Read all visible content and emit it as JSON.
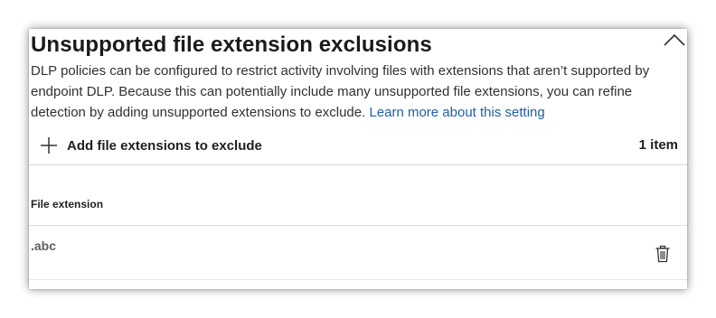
{
  "section": {
    "title": "Unsupported file extension exclusions",
    "description": "DLP policies can be configured to restrict activity involving files with extensions that aren’t supported by endpoint DLP. Because this can potentially include many unsupported file extensions, you can refine detection by adding unsupported extensions to exclude.",
    "learn_more_link": "Learn more about this setting",
    "collapse_icon": "chevron-up-icon"
  },
  "toolbar": {
    "add_label": "Add file extensions to exclude",
    "add_icon": "plus-icon",
    "item_count": "1 item"
  },
  "table": {
    "column_header": "File extension",
    "rows": [
      {
        "extension": ".abc",
        "delete_icon": "trash-icon"
      }
    ]
  },
  "colors": {
    "link": "#1f5fa8",
    "text": "#201f1e",
    "muted": "#605e5c",
    "divider": "#d6d6d6"
  }
}
